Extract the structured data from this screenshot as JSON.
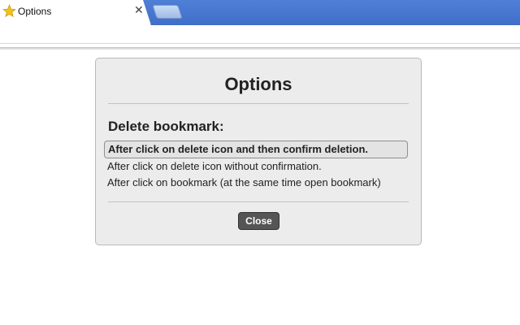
{
  "browser": {
    "tab_title": "Options",
    "tab_close": "✕",
    "favicon": "star-icon",
    "colors": {
      "tabstrip": "#4f7fd6",
      "favicon": "#f2c21b"
    }
  },
  "dialog": {
    "title": "Options",
    "section_heading": "Delete bookmark:",
    "options": [
      {
        "label": "After click on delete icon and then confirm deletion.",
        "selected": true
      },
      {
        "label": "After click on delete icon without confirmation.",
        "selected": false
      },
      {
        "label": "After click on bookmark (at the same time open bookmark)",
        "selected": false
      }
    ],
    "close_label": "Close",
    "colors": {
      "background": "#ececec",
      "button": "#555555"
    }
  }
}
